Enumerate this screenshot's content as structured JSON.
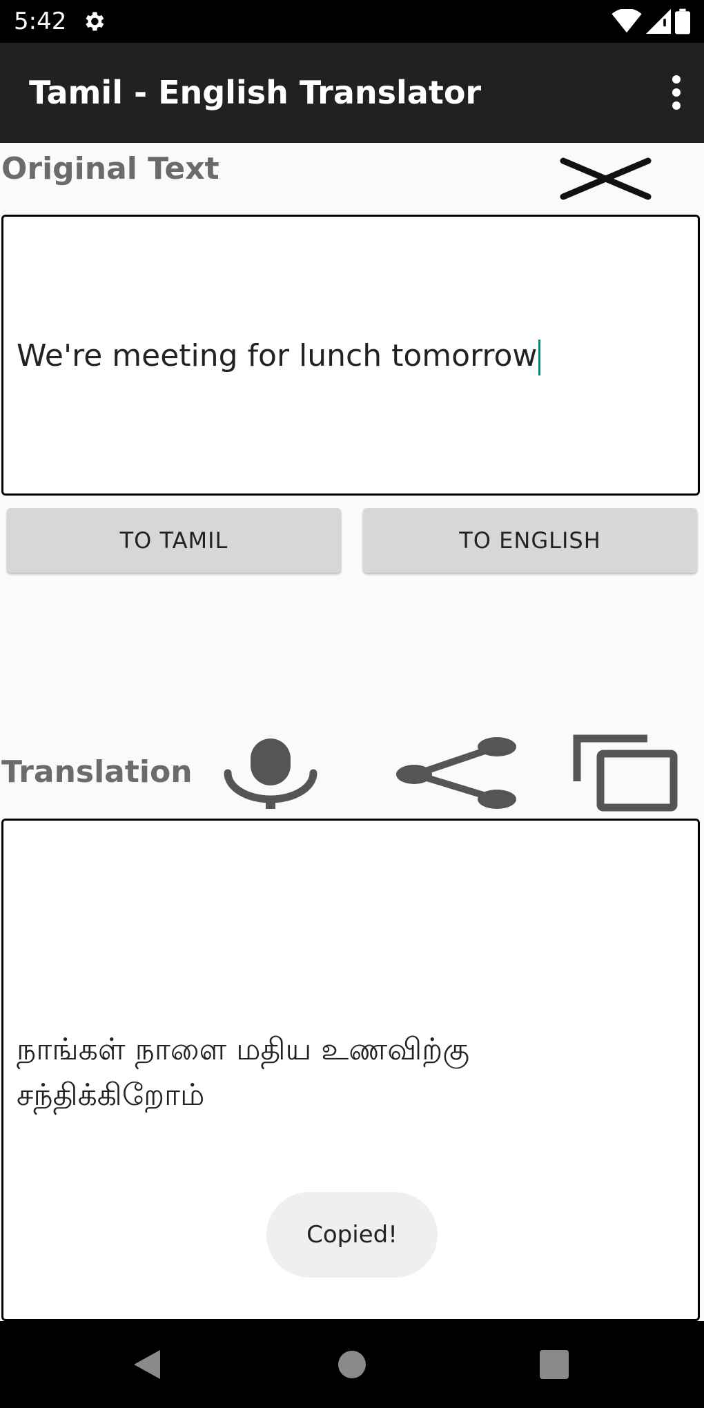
{
  "status_bar": {
    "time": "5:42",
    "icons": [
      "settings-gear-icon",
      "wifi-icon",
      "signal-icon",
      "battery-icon"
    ]
  },
  "app_bar": {
    "title": "Tamil - English Translator",
    "menu_icon": "overflow-menu-icon"
  },
  "original": {
    "label": "Original Text",
    "text": "We're meeting for lunch tomorrow",
    "clear_icon": "close-icon"
  },
  "buttons": {
    "to_tamil": "TO TAMIL",
    "to_english": "TO ENGLISH"
  },
  "translation": {
    "label": "Translation",
    "text": "நாங்கள் நாளை மதிய உணவிற்கு சந்திக்கிறோம்",
    "icons": [
      "microphone-icon",
      "share-icon",
      "copy-icon"
    ]
  },
  "toast": {
    "message": "Copied!"
  },
  "nav_bar": {
    "icons": [
      "back-icon",
      "home-icon",
      "recents-icon"
    ]
  },
  "colors": {
    "status_bar": "#000000",
    "app_bar": "#212121",
    "background": "#fafafa",
    "label_gray": "#6b6b6b",
    "icon_gray": "#555555",
    "button_gray": "#d6d7d7",
    "caret_teal": "#00897b",
    "toast_bg": "#efefef"
  }
}
